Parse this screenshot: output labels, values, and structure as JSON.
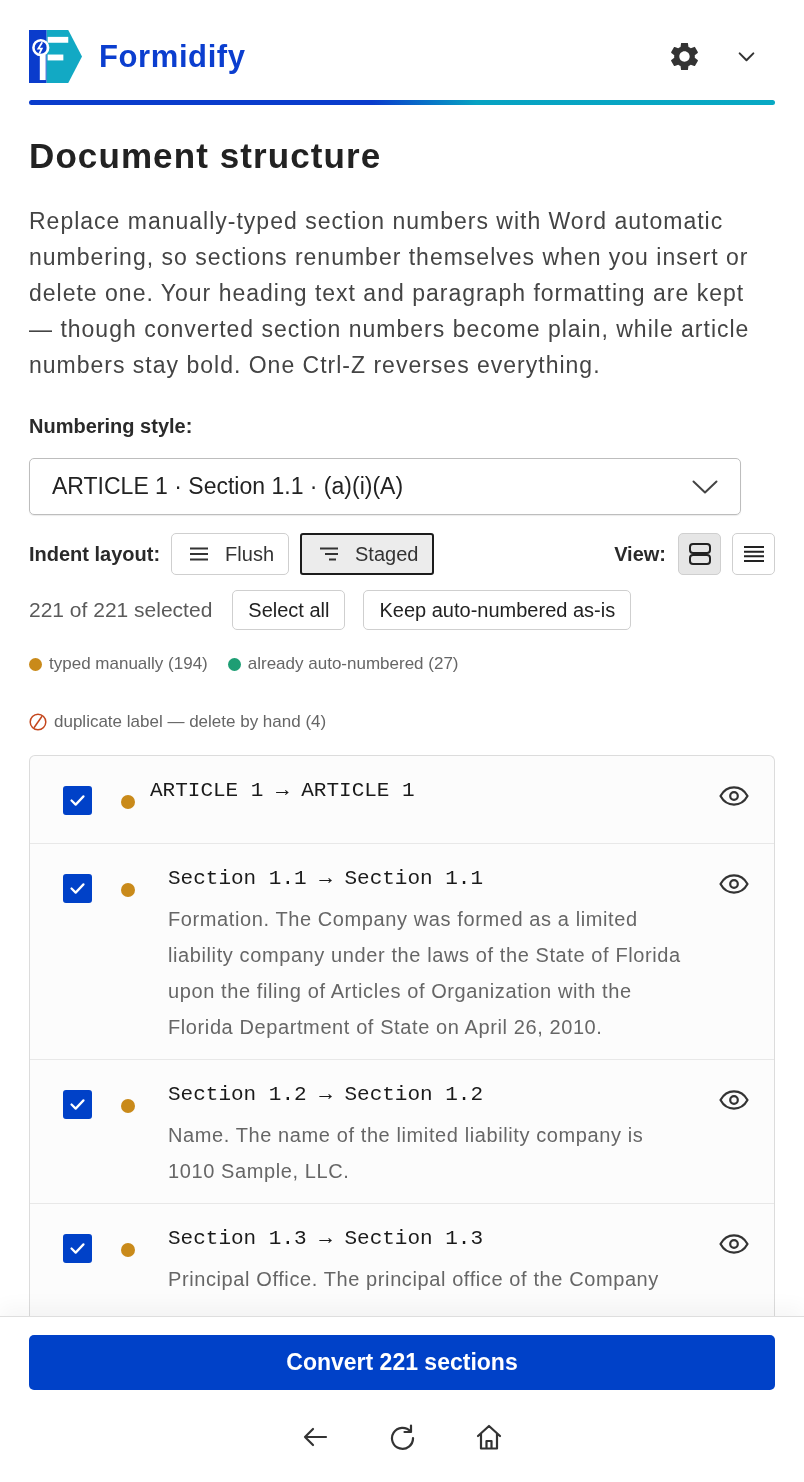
{
  "header": {
    "brand": "Formidify"
  },
  "title": "Document structure",
  "description": "Replace manually-typed section numbers with Word automatic numbering, so sections renumber themselves when you insert or delete one. Your heading text and paragraph formatting are kept — though converted section numbers become plain, while article numbers stay bold. One Ctrl-Z reverses everything.",
  "numbering_style": {
    "label": "Numbering style:",
    "value": "ARTICLE 1 · Section 1.1 · (a)(i)(A)"
  },
  "indent_layout": {
    "label": "Indent layout:",
    "options": [
      {
        "kind": "flush",
        "label": "Flush",
        "selected": false
      },
      {
        "kind": "staged",
        "label": "Staged",
        "selected": true
      }
    ]
  },
  "view": {
    "label": "View:",
    "options": [
      {
        "kind": "cards",
        "selected": true
      },
      {
        "kind": "compact",
        "selected": false
      }
    ]
  },
  "selection": {
    "count": "221 of 221 selected",
    "buttons": [
      "Select all",
      "Keep auto-numbered as-is"
    ]
  },
  "legend": [
    {
      "kind": "dot",
      "label": "typed manually (194)",
      "color": "#c98a1a"
    },
    {
      "kind": "dot",
      "label": "already auto-numbered (27)",
      "color": "#1e9e74"
    },
    {
      "kind": "duplicate",
      "label": "duplicate label — delete by hand (4)"
    }
  ],
  "sections": [
    {
      "mapping": "ARTICLE 1 → ARTICLE 1",
      "checked": true,
      "color": "#c98a1a",
      "children": [
        {
          "mapping": "Section 1.1 → Section 1.1",
          "text": "Formation. The Company was formed as a limited liability company under the laws of the State of Florida upon the filing of Articles of Organization with the Florida Department of State on April 26, 2010.",
          "checked": true,
          "color": "#c98a1a"
        },
        {
          "mapping": "Section 1.2 → Section 1.2",
          "text": "Name. The name of the limited liability company is 1010 Sample, LLC.",
          "checked": true,
          "color": "#c98a1a"
        },
        {
          "mapping": "Section 1.3 → Section 1.3",
          "text": "Principal Office. The principal office of the Company",
          "checked": true,
          "color": "#c98a1a"
        }
      ]
    }
  ],
  "footer": {
    "convert_button": "Convert 221 sections"
  }
}
